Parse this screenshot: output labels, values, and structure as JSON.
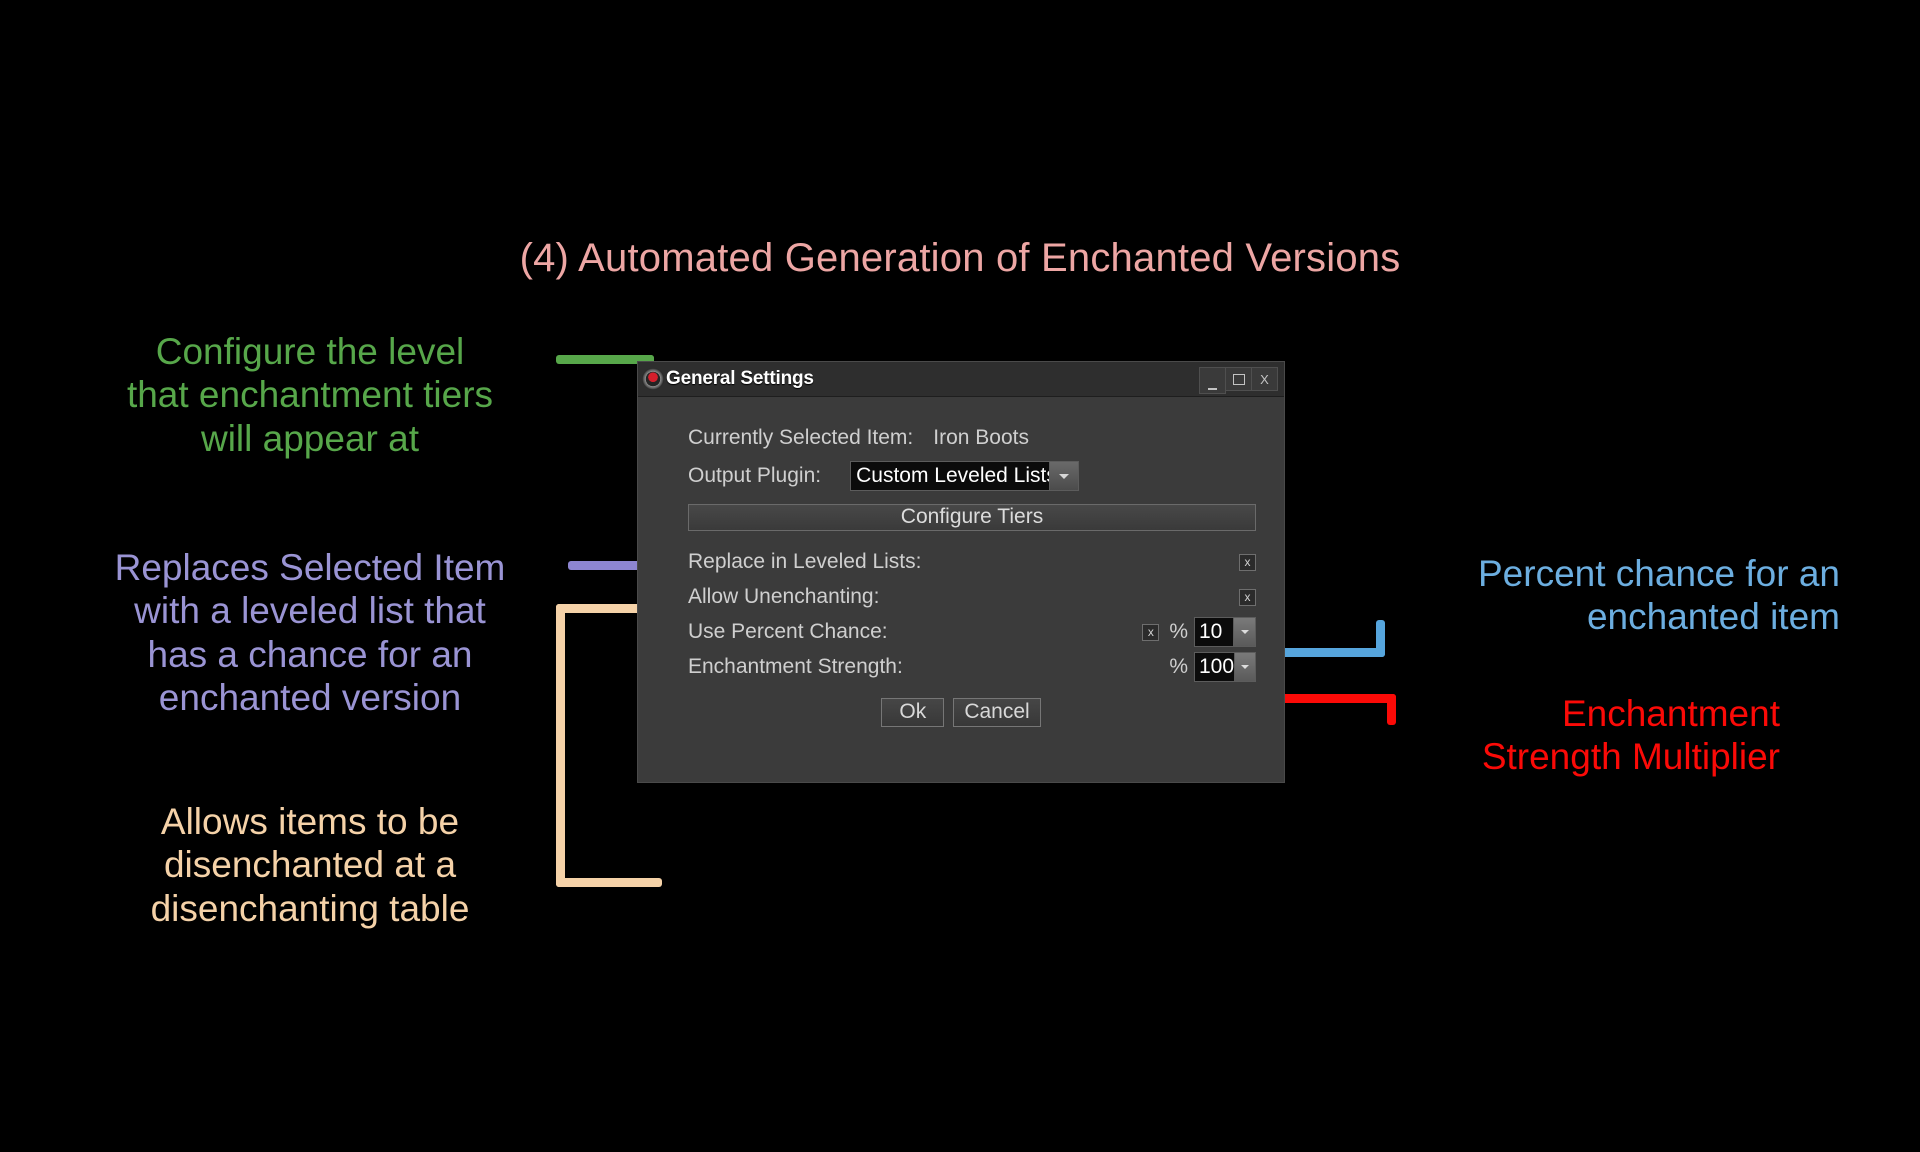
{
  "title": "(4) Automated Generation of Enchanted Versions",
  "colors": {
    "title": "#eda6a4",
    "green": "#57a74a",
    "purple": "#9a94d4",
    "tan": "#f5d2a8",
    "blue": "#6caee0",
    "red": "#fb0a07",
    "dialog_bg": "#3b3b3b",
    "titlebar_bg": "#2e2e2e"
  },
  "annotations": {
    "green": {
      "lines": [
        "Configure the level",
        "that enchantment tiers",
        "will appear at"
      ]
    },
    "purple": {
      "lines": [
        "Replaces Selected Item",
        "with a leveled list that",
        "has a chance for an",
        "enchanted version"
      ]
    },
    "tan": {
      "lines": [
        "Allows items to be",
        "disenchanted at a",
        "disenchanting table"
      ]
    },
    "blue": {
      "lines": [
        "Percent chance for an",
        "enchanted item"
      ]
    },
    "red": {
      "lines": [
        "Enchantment",
        "Strength Multiplier"
      ]
    }
  },
  "dialog": {
    "title": "General Settings",
    "icon": "skyrim-dragon-icon",
    "window_buttons": {
      "minimize": "_",
      "maximize": "□",
      "close": "X"
    },
    "rows": {
      "selected_item": {
        "label": "Currently Selected Item:",
        "value": "Iron Boots"
      },
      "output_plugin": {
        "label": "Output Plugin:",
        "value": "Custom Leveled Lists.esp",
        "arrow": "chevron-down-icon"
      },
      "configure_tiers": {
        "label": "Configure Tiers"
      },
      "replace_in_leveled_lists": {
        "label": "Replace in Leveled Lists:",
        "checked_mark": "x",
        "checked": true
      },
      "allow_unenchanting": {
        "label": "Allow Unenchanting:",
        "checked_mark": "x",
        "checked": true
      },
      "use_percent_chance": {
        "label": "Use Percent Chance:",
        "checked_mark": "x",
        "checked": true,
        "percent_symbol": "%",
        "value": "10"
      },
      "enchantment_strength": {
        "label": "Enchantment Strength:",
        "percent_symbol": "%",
        "value": "100"
      }
    },
    "buttons": {
      "ok": "Ok",
      "cancel": "Cancel"
    }
  }
}
